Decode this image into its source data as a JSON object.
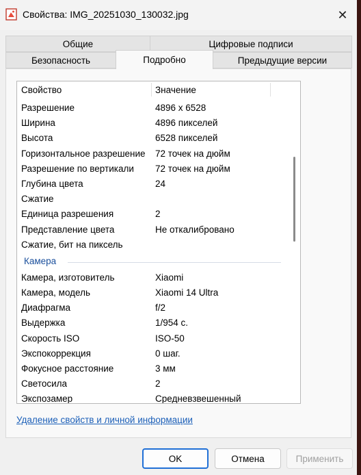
{
  "window": {
    "title": "Свойства: IMG_20251030_130032.jpg",
    "close_glyph": "✕"
  },
  "tabs": {
    "row1": [
      "Общие",
      "Цифровые подписи"
    ],
    "row2": [
      "Безопасность",
      "Подробно",
      "Предыдущие версии"
    ],
    "active": "Подробно"
  },
  "list": {
    "header": {
      "property": "Свойство",
      "value": "Значение"
    },
    "image_rows": [
      {
        "prop": "Разрешение",
        "val": "4896 x 6528"
      },
      {
        "prop": "Ширина",
        "val": "4896 пикселей"
      },
      {
        "prop": "Высота",
        "val": "6528 пикселей"
      },
      {
        "prop": "Горизонтальное разрешение",
        "val": "72 точек на дюйм"
      },
      {
        "prop": "Разрешение по вертикали",
        "val": "72 точек на дюйм"
      },
      {
        "prop": "Глубина цвета",
        "val": "24"
      },
      {
        "prop": "Сжатие",
        "val": ""
      },
      {
        "prop": "Единица разрешения",
        "val": "2"
      },
      {
        "prop": "Представление цвета",
        "val": "Не откалибровано"
      },
      {
        "prop": "Сжатие, бит на пиксель",
        "val": ""
      }
    ],
    "camera_group": "Камера",
    "camera_rows": [
      {
        "prop": "Камера, изготовитель",
        "val": "Xiaomi"
      },
      {
        "prop": "Камера, модель",
        "val": "Xiaomi 14 Ultra"
      },
      {
        "prop": "Диафрагма",
        "val": "f/2"
      },
      {
        "prop": "Выдержка",
        "val": "1/954 с."
      },
      {
        "prop": "Скорость ISO",
        "val": "ISO-50"
      },
      {
        "prop": "Экспокоррекция",
        "val": "0 шаг."
      },
      {
        "prop": "Фокусное расстояние",
        "val": "3 мм"
      },
      {
        "prop": "Светосила",
        "val": "2"
      },
      {
        "prop": "Экспозамер",
        "val": "Средневзвешенный"
      }
    ]
  },
  "link": "Удаление свойств и личной информации",
  "buttons": {
    "ok": "OK",
    "cancel": "Отмена",
    "apply": "Применить"
  },
  "colors": {
    "accent": "#1f6fd6",
    "group": "#1a4f9c",
    "link": "#1b5fb8"
  }
}
